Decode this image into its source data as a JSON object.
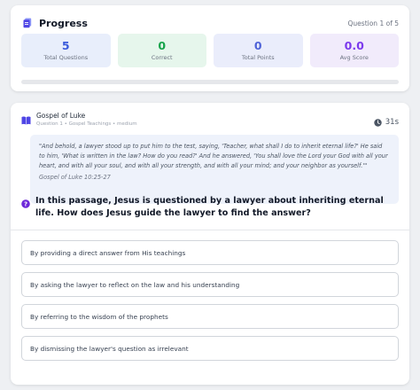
{
  "progress": {
    "title": "Progress",
    "question_counter": "Question 1 of 5",
    "completed_fraction": 0.0,
    "stats": [
      {
        "value": "5",
        "label": "Total Questions"
      },
      {
        "value": "0",
        "label": "Correct"
      },
      {
        "value": "0",
        "label": "Total Points"
      },
      {
        "value": "0.0",
        "label": "Avg Score"
      }
    ]
  },
  "question": {
    "book": "Gospel of Luke",
    "meta": "Question 1 • Gospel Teachings • medium",
    "timer": "31s",
    "passage": "\"And behold, a lawyer stood up to put him to the test, saying, 'Teacher, what shall I do to inherit eternal life?' He said to him, 'What is written in the law? How do you read?' And he answered, 'You shall love the Lord your God with all your heart, and with all your soul, and with all your strength, and with all your mind; and your neighbor as yourself.'\"",
    "reference": "Gospel of Luke 10:25-27",
    "prompt": "In this passage, Jesus is questioned by a lawyer about inheriting eternal life. How does Jesus guide the lawyer to find the answer?",
    "options": [
      "By providing a direct answer from His teachings",
      "By asking the lawyer to reflect on the law and his understanding",
      "By referring to the wisdom of the prophets",
      "By dismissing the lawyer's question as irrelevant"
    ]
  },
  "colors": {
    "accent": "#6366f1",
    "total_questions": "#3b5bdb",
    "correct": "#16a34a",
    "total_points": "#4f63d8",
    "avg_score": "#7c3aed"
  },
  "icons": {
    "progress": "document-icon",
    "book": "book-icon",
    "timer": "clock-icon",
    "question": "question-mark-icon"
  }
}
